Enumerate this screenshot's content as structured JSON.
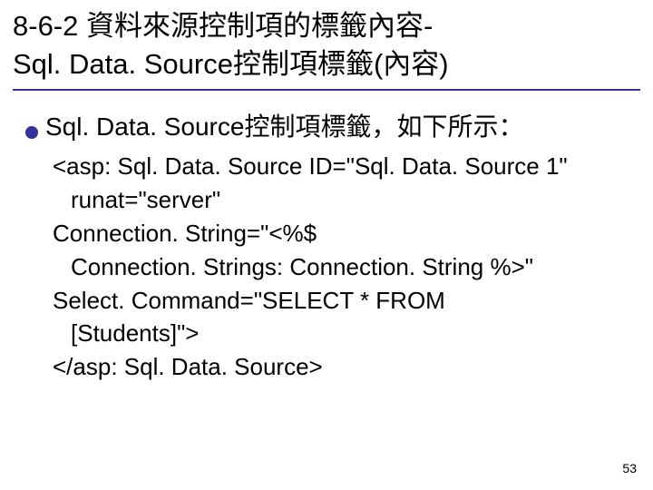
{
  "title": {
    "line1": "8-6-2 資料來源控制項的標籤內容-",
    "line2": "Sql. Data. Source控制項標籤(內容)"
  },
  "bullet": "Sql. Data. Source控制項標籤，如下所示：",
  "code": {
    "l1": "<asp: Sql. Data. Source ID=\"Sql. Data. Source 1\"",
    "l2": "runat=\"server\"",
    "l3": "Connection. String=\"<%$",
    "l4": "Connection. Strings: Connection. String %>\"",
    "l5": "Select. Command=\"SELECT * FROM",
    "l6": "[Students]\">",
    "l7": "</asp: Sql. Data. Source>"
  },
  "page_number": "53"
}
